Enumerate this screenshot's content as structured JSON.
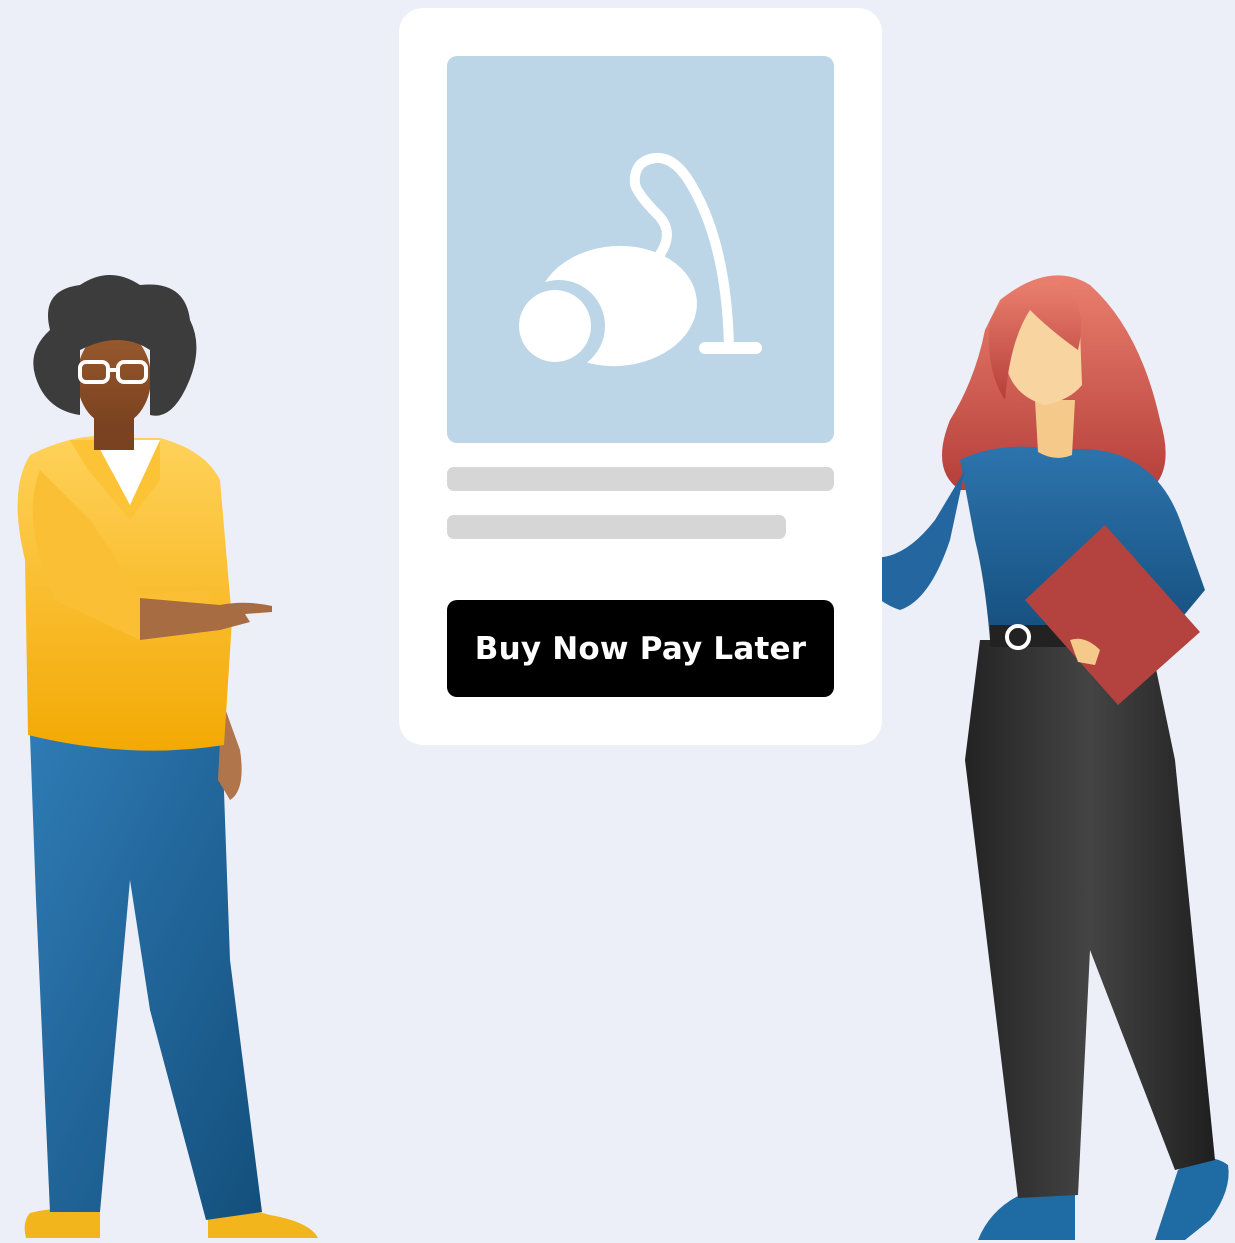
{
  "product_card": {
    "image_icon": "vacuum-cleaner-icon",
    "button_label": "Buy Now Pay Later"
  },
  "colors": {
    "background": "#eceff8",
    "card": "#ffffff",
    "image_panel": "#bcd6e8",
    "placeholder_line": "#d6d6d6",
    "button": "#000000",
    "button_text": "#ffffff"
  }
}
